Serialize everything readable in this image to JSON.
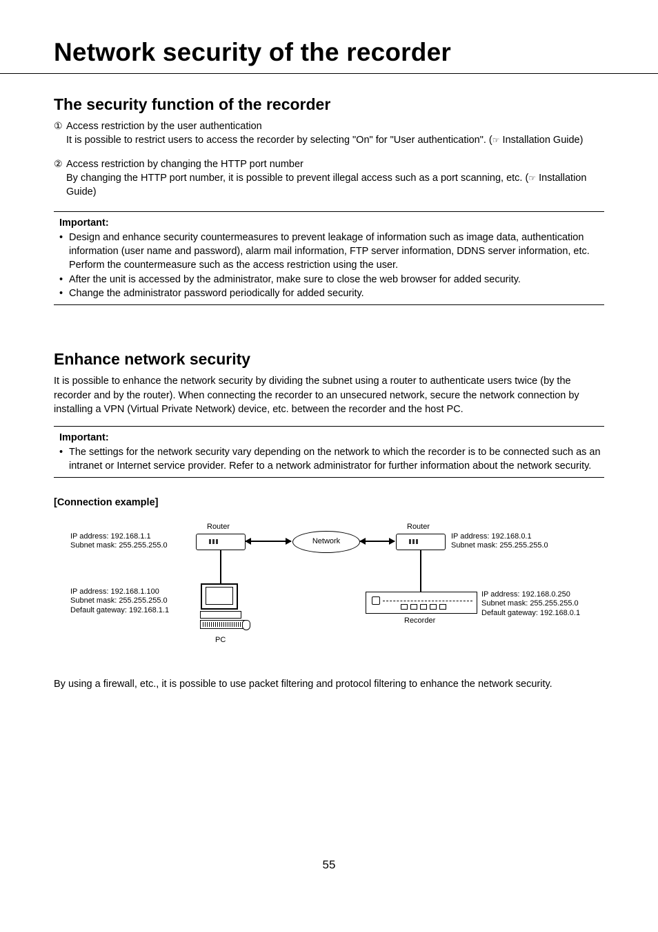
{
  "chapter_title": "Network security of the recorder",
  "section1": {
    "title": "The security function of the recorder",
    "item1": {
      "num": "q",
      "head": "Access restriction by the user authentication",
      "body_a": "It is possible to restrict users to access the recorder by selecting \"On\" for \"User authentication\". (",
      "body_b": " Installation Guide)"
    },
    "item2": {
      "num": "w",
      "head": "Access restriction by changing the HTTP port number",
      "body_a": "By changing the HTTP port number, it is possible to prevent illegal access such as a port scanning, etc. (",
      "body_b": " Installation Guide)"
    },
    "important": {
      "label": "Important:",
      "b1": "Design and enhance security countermeasures to prevent leakage of information such as image data, authentication information (user name and password), alarm mail information, FTP server information, DDNS server information, etc. Perform the countermeasure such as the access restriction using the user.",
      "b2": "After the unit is accessed by the administrator, make sure to close the web browser for added security.",
      "b3": "Change the administrator password periodically for added security."
    }
  },
  "section2": {
    "title": "Enhance network security",
    "para": "It is possible to enhance the network security by dividing the subnet using a router to authenticate users twice (by the recorder and by the router). When connecting the recorder to an unsecured network, secure the network connection by installing a VPN (Virtual Private Network) device, etc. between the recorder and the host PC.",
    "important": {
      "label": "Important:",
      "b1": "The settings for the network security vary depending on the network to which the recorder is to be connected such as an intranet or Internet service provider. Refer to a network administrator for further information about the network security."
    },
    "conn_title": "[Connection example]",
    "diagram": {
      "router": "Router",
      "network": "Network",
      "pc": "PC",
      "recorder": "Recorder",
      "router_left": "IP address: 192.168.1.1\nSubnet mask: 255.255.255.0",
      "router_right": "IP address: 192.168.0.1\nSubnet mask: 255.255.255.0",
      "pc_info": "IP address: 192.168.1.100\nSubnet mask: 255.255.255.0\nDefault gateway: 192.168.1.1",
      "rec_info": "IP address: 192.168.0.250\nSubnet mask: 255.255.255.0\nDefault gateway: 192.168.0.1"
    },
    "closing": "By using a firewall, etc., it is possible to use packet filtering and protocol filtering to enhance the network security."
  },
  "page_number": "55",
  "ref_icon": "☞"
}
